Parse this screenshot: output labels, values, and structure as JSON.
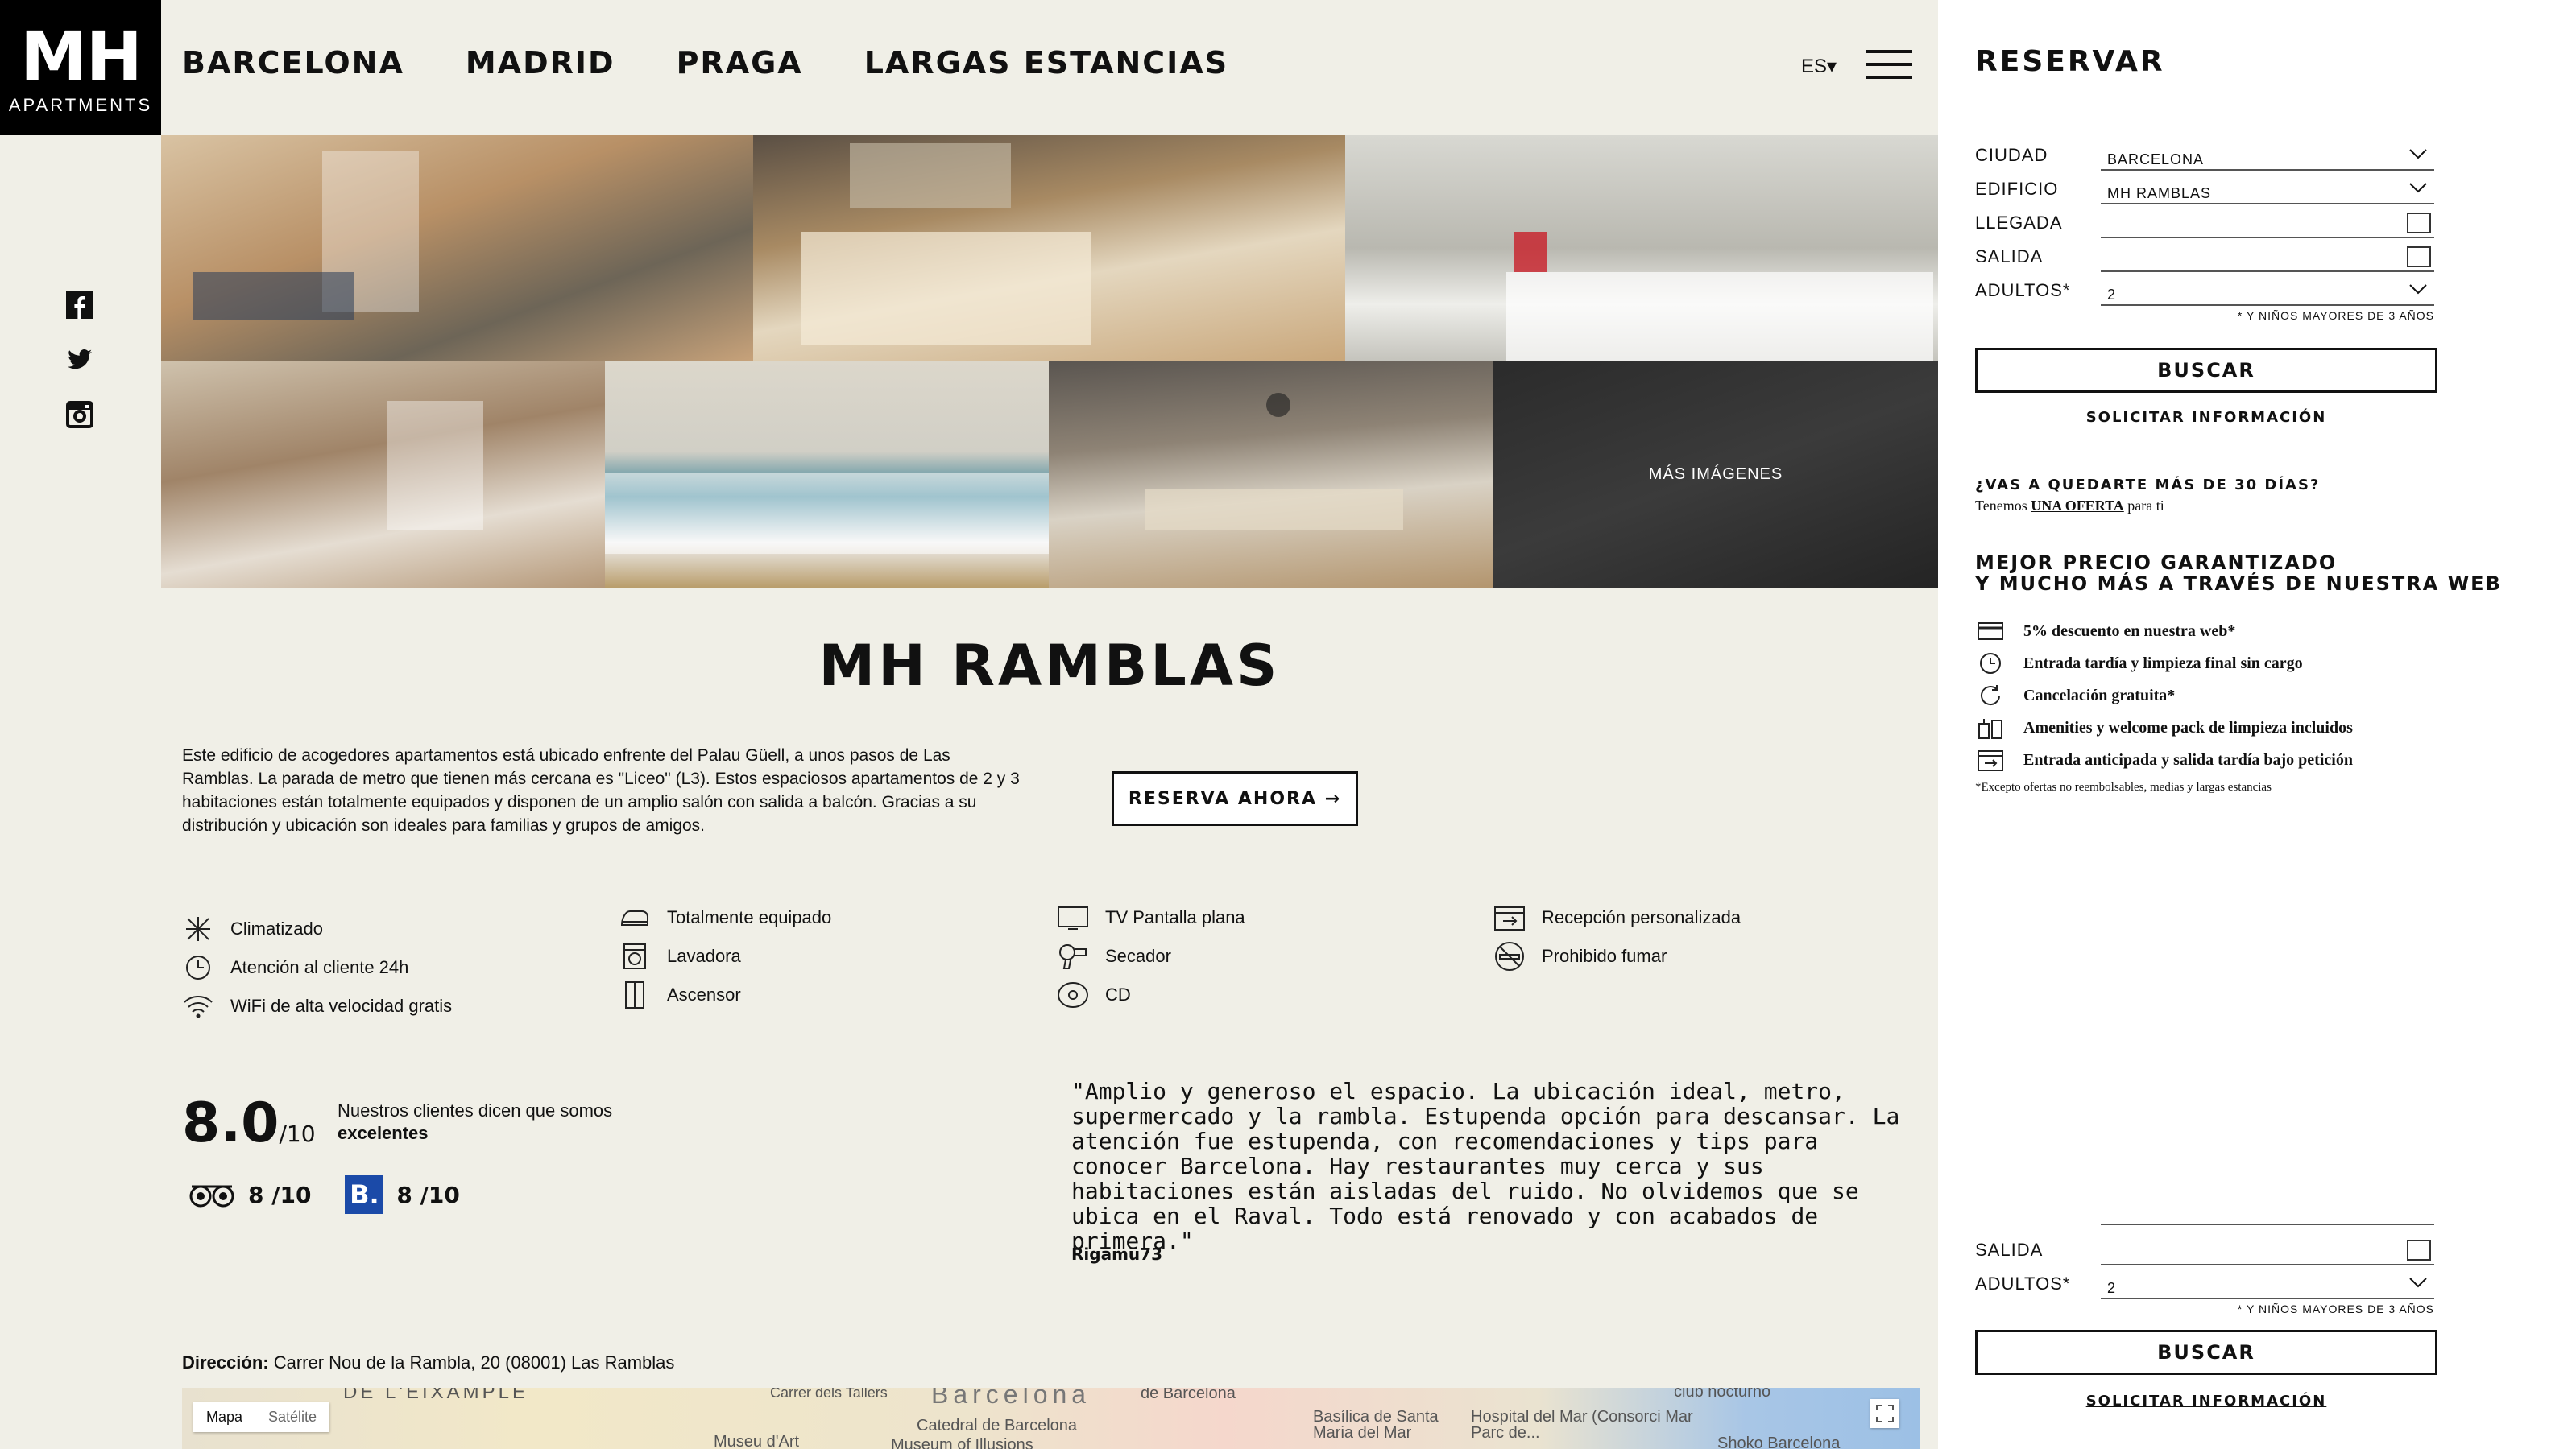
{
  "header": {
    "logo_main": "MH",
    "logo_sub": "APARTMENTS",
    "nav": [
      "BARCELONA",
      "MADRID",
      "PRAGA",
      "LARGAS ESTANCIAS"
    ],
    "lang": "ES▾"
  },
  "gallery": {
    "more_label": "MÁS IMÁGENES"
  },
  "main": {
    "title": "MH RAMBLAS",
    "description": "Este edificio de acogedores apartamentos está ubicado enfrente del Palau Güell, a unos pasos de Las Ramblas. La parada de metro que tienen más cercana es \"Liceo\" (L3). Estos espaciosos apartamentos de 2 y 3 habitaciones están totalmente equipados y disponen de un amplio salón con salida a balcón. Gracias a su distribución y ubicación son ideales para familias y grupos de amigos.",
    "reserve_button": "RESERVA AHORA →",
    "amenities": [
      {
        "label": "Climatizado",
        "icon": "snowflake-icon"
      },
      {
        "label": "Atención al cliente 24h",
        "icon": "clock-24-icon"
      },
      {
        "label": "WiFi de alta velocidad gratis",
        "icon": "wifi-icon"
      },
      {
        "label": "Totalmente equipado",
        "icon": "iron-icon"
      },
      {
        "label": "Lavadora",
        "icon": "washing-machine-icon"
      },
      {
        "label": "Ascensor",
        "icon": "elevator-icon"
      },
      {
        "label": "TV Pantalla plana",
        "icon": "tv-icon"
      },
      {
        "label": "Secador",
        "icon": "hair-dryer-icon"
      },
      {
        "label": "CD",
        "icon": "cd-icon"
      },
      {
        "label": "Recepción personalizada",
        "icon": "calendar-checkin-icon"
      },
      {
        "label": "Prohibido fumar",
        "icon": "no-smoking-icon"
      }
    ],
    "score": {
      "value": "8.0",
      "of": "/10",
      "text": "Nuestros clientes dicen que somos",
      "bold": "excelentes",
      "tripadvisor": "8 /10",
      "booking_badge": "B.",
      "booking": "8 /10"
    },
    "quote": {
      "text": "\"Amplio y generoso el espacio. La ubicación ideal, metro, supermercado y la rambla. Estupenda opción para descansar. La atención fue estupenda, con recomendaciones y tips para conocer Barcelona. Hay restaurantes muy cerca y sus habitaciones están aisladas del ruido. No olvidemos que se ubica en el Raval. Todo está renovado y con acabados de primera.\"",
      "author": "Rigamu73"
    },
    "address": {
      "label": "Dirección:",
      "value": "Carrer Nou de la Rambla, 20 (08001) Las Ramblas"
    },
    "map": {
      "tab_map": "Mapa",
      "tab_sat": "Satélite",
      "labels": [
        "DE L'EIXAMPLE",
        "Carrer dels Tallers",
        "Barcelona",
        "de Barcelona",
        "Museu d'Art",
        "Catedral de Barcelona",
        "Museum of Illusions",
        "Basílica de Santa Maria del Mar",
        "Hospital del Mar (Consorci Mar Parc de...",
        "club nocturno",
        "Shoko Barcelona"
      ]
    }
  },
  "side": {
    "title": "RESERVAR",
    "form": {
      "city_label": "CIUDAD",
      "city_value": "BARCELONA",
      "building_label": "EDIFICIO",
      "building_value": "MH RAMBLAS",
      "arrival_label": "LLEGADA",
      "departure_label": "SALIDA",
      "adults_label": "ADULTOS*",
      "adults_value": "2",
      "note": "* Y NIÑOS MAYORES DE 3 AÑOS"
    },
    "search_button": "BUSCAR",
    "info_link": "SOLICITAR INFORMACIÓN",
    "stay": {
      "heading": "¿VAS A QUEDARTE MÁS DE 30 DÍAS?",
      "text_before": "Tenemos",
      "link": "UNA OFERTA",
      "text_after": "para ti"
    },
    "best": {
      "line1": "MEJOR PRECIO GARANTIZADO",
      "line2": "Y MUCHO MÁS A TRAVÉS DE NUESTRA WEB"
    },
    "benefits": [
      {
        "label": "5% descuento en nuestra web*",
        "icon": "card-icon"
      },
      {
        "label": "Entrada tardía y limpieza final sin cargo",
        "icon": "clock-icon"
      },
      {
        "label": "Cancelación gratuita*",
        "icon": "refresh-icon"
      },
      {
        "label": "Amenities y welcome pack de limpieza incluidos",
        "icon": "amenities-icon"
      },
      {
        "label": "Entrada anticipada y salida tardía bajo petición",
        "icon": "calendar-icon"
      }
    ],
    "benefits_note": "*Excepto ofertas no reembolsables, medias y largas estancias",
    "sticky": {
      "departure_label": "SALIDA",
      "adults_label": "ADULTOS*",
      "adults_value": "2",
      "note": "* Y NIÑOS MAYORES DE 3 AÑOS",
      "search_button": "BUSCAR",
      "info_link": "SOLICITAR INFORMACIÓN"
    }
  }
}
